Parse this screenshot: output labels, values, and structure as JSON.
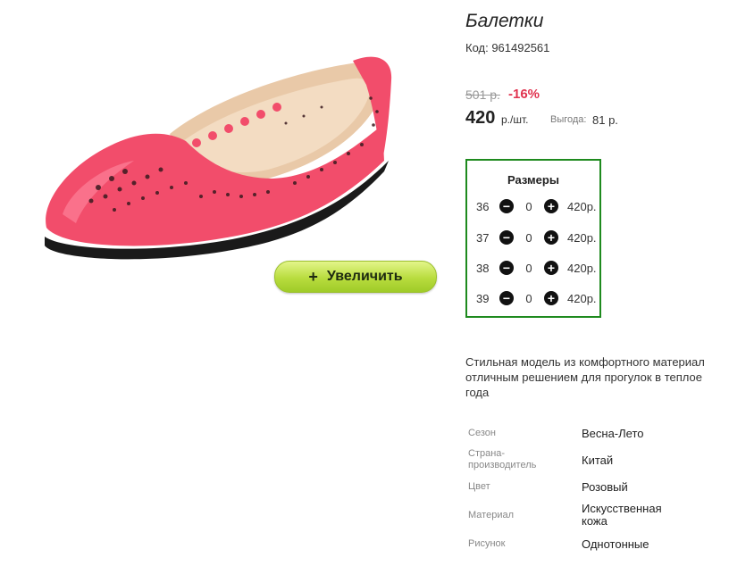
{
  "product": {
    "title": "Балетки",
    "code": "Код: 961492561",
    "old_price": "501 р.",
    "discount": "-16%",
    "price": "420",
    "price_unit": "р./шт.",
    "saving_label": "Выгода:",
    "saving_value": "81 р."
  },
  "zoom_button": {
    "icon": "+",
    "label": "Увеличить"
  },
  "sizes": {
    "title": "Размеры",
    "rows": [
      {
        "size": "36",
        "qty": "0",
        "price": "420р."
      },
      {
        "size": "37",
        "qty": "0",
        "price": "420р."
      },
      {
        "size": "38",
        "qty": "0",
        "price": "420р."
      },
      {
        "size": "39",
        "qty": "0",
        "price": "420р."
      }
    ]
  },
  "description": {
    "line1": "Стильная модель из комфортного материал",
    "line2": "отличным решением для прогулок в теплое",
    "line3": "года"
  },
  "attributes": [
    {
      "label": "Сезон",
      "value": "Весна-Лето"
    },
    {
      "label_line1": "Страна-",
      "label_line2": "производитель",
      "value": "Китай"
    },
    {
      "label": "Цвет",
      "value": "Розовый"
    },
    {
      "label": "Материал",
      "value_line1": "Искусственная",
      "value_line2": "кожа"
    },
    {
      "label": "Рисунок",
      "value": "Однотонные"
    }
  ],
  "colors": {
    "accent_red": "#e0334f",
    "box_border": "#1e8a1e",
    "button_green": "#b8dc3e",
    "shoe_pink": "#f24d6b"
  }
}
